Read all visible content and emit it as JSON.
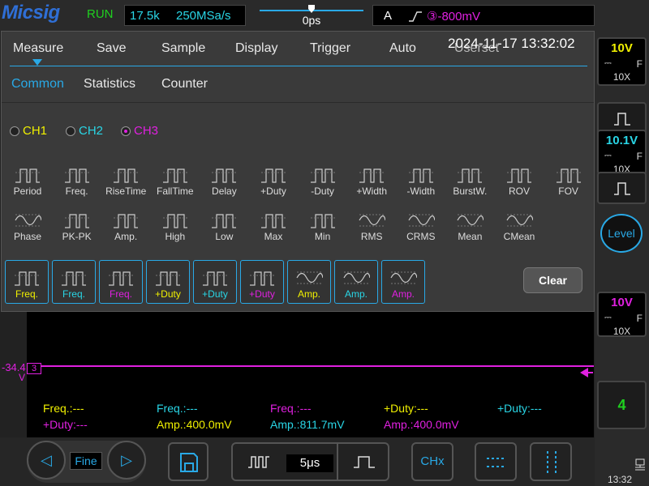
{
  "topbar": {
    "logo": "Micsig",
    "run": "RUN",
    "acq_points": "17.5k",
    "sample_rate": "250MSa/s",
    "trigger_pos": "0ps",
    "trig_mode": "A",
    "trig_channel_level": "③-800mV"
  },
  "menu": {
    "tabs": [
      "Measure",
      "Save",
      "Sample",
      "Display",
      "Trigger",
      "Auto",
      "Userset"
    ],
    "timestamp": "2024-11-17 13:32:02",
    "subtabs": [
      "Common",
      "Statistics",
      "Counter"
    ],
    "channels": [
      "CH1",
      "CH2",
      "CH3"
    ],
    "items_row1": [
      "Period",
      "Freq.",
      "RiseTime",
      "FallTime",
      "Delay",
      "+Duty",
      "-Duty",
      "+Width",
      "-Width",
      "BurstW.",
      "ROV",
      "FOV"
    ],
    "items_row2": [
      "Phase",
      "PK-PK",
      "Amp.",
      "High",
      "Low",
      "Max",
      "Min",
      "RMS",
      "CRMS",
      "Mean",
      "CMean"
    ],
    "selected": [
      {
        "label": "Freq.",
        "ch": "CH1"
      },
      {
        "label": "Freq.",
        "ch": "CH2"
      },
      {
        "label": "Freq.",
        "ch": "CH3"
      },
      {
        "label": "+Duty",
        "ch": "CH1"
      },
      {
        "label": "+Duty",
        "ch": "CH2"
      },
      {
        "label": "+Duty",
        "ch": "CH3"
      },
      {
        "label": "Amp.",
        "ch": "CH1"
      },
      {
        "label": "Amp.",
        "ch": "CH2"
      },
      {
        "label": "Amp.",
        "ch": "CH3"
      }
    ],
    "clear": "Clear"
  },
  "scope": {
    "offset_label": "-34.4",
    "offset_unit": "V",
    "ch_marker": "3"
  },
  "readouts": {
    "r1": [
      "Freq.:---",
      "Freq.:---",
      "Freq.:---",
      "+Duty:---",
      "+Duty:---"
    ],
    "r2": [
      "+Duty:---",
      "Amp.:400.0mV",
      "Amp.:811.7mV",
      "Amp.:400.0mV"
    ]
  },
  "side": {
    "ch1_v": "10V",
    "ch1_f": "F",
    "ch1_x": "10X",
    "ch2_v": "10.1V",
    "ch2_f": "F",
    "ch2_x": "10X",
    "level": "Level",
    "ch3_v": "10V",
    "ch3_f": "F",
    "ch3_x": "10X",
    "counter": "4",
    "clock": "13:32"
  },
  "bottom": {
    "fine": "Fine",
    "timebase": "5μs",
    "chx": "CHx"
  },
  "colors": {
    "ch1": "#f0f000",
    "ch2": "#29d6e6",
    "ch3": "#e020e0",
    "accent": "#29a9e6"
  }
}
